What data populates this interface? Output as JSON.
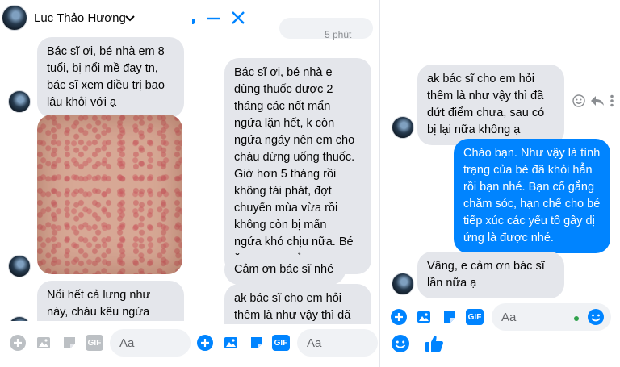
{
  "header": {
    "contact_name": "Lục Thảo Hương",
    "partial_status": "5 phút"
  },
  "chat_left": {
    "messages": [
      "Bác sĩ ơi, bé nhà em 8\ntuổi, bị nổi mề đay tn,\nbác sĩ xem điều trị bao\nlâu khỏi với ạ",
      "Nổi hết cả lưng như\nnày, cháu kêu ngứa"
    ]
  },
  "chat_middle": {
    "messages": [
      "Bác sĩ ơi, bé nhà e\ndùng thuốc được 2\ntháng các nốt mẩn\nngứa lặn hết, k còn\nngứa ngáy nên em cho\ncháu dừng uống thuốc.\nGiờ hơn 5 tháng rồi\nkhông tái phát, đợt\nchuyển mùa vừa rồi\nkhông còn bị mẩn\nngứa khó chịu nữa. Bé\năn ngon, ngủ ngon.",
      "Cảm ơn bác sĩ nhé",
      "ak bác sĩ cho em hỏi\nthêm là  như vậy thì đã"
    ]
  },
  "chat_right": {
    "messages": [
      {
        "text": "ak bác sĩ cho em hỏi\nthêm là  như vậy thì đã\ndứt điểm chưa, sau có\nbị lại nữa không ạ",
        "from_me": false
      },
      {
        "text": "Chào bạn. Như vậy là tình\ntrạng của bé đã khỏi hẳn\nrồi bạn nhé. Bạn cố gắng\nchăm sóc, hạn chế cho bé\ntiếp xúc các yếu tố gây dị\nứng là được nhé.",
        "from_me": true
      },
      {
        "text": "Vâng, e cảm ơn bác sĩ\nlần nữa ạ",
        "from_me": false
      }
    ]
  },
  "composer": {
    "placeholder": "Aa",
    "gif_label": "GIF"
  },
  "colors": {
    "accent": "#0084ff",
    "bubble_gray": "#e4e6eb",
    "icon_gray": "#bcc0c4",
    "online_green": "#31a24c",
    "emoji_yellow": "#f7b928"
  },
  "icons": [
    "video-camera-icon",
    "phone-icon",
    "minimize-icon",
    "close-icon",
    "chevron-down-icon",
    "plus-icon",
    "photo-icon",
    "sticker-icon",
    "gif-icon",
    "emoji-icon",
    "like-icon",
    "react-icon",
    "reply-icon",
    "more-icon"
  ]
}
